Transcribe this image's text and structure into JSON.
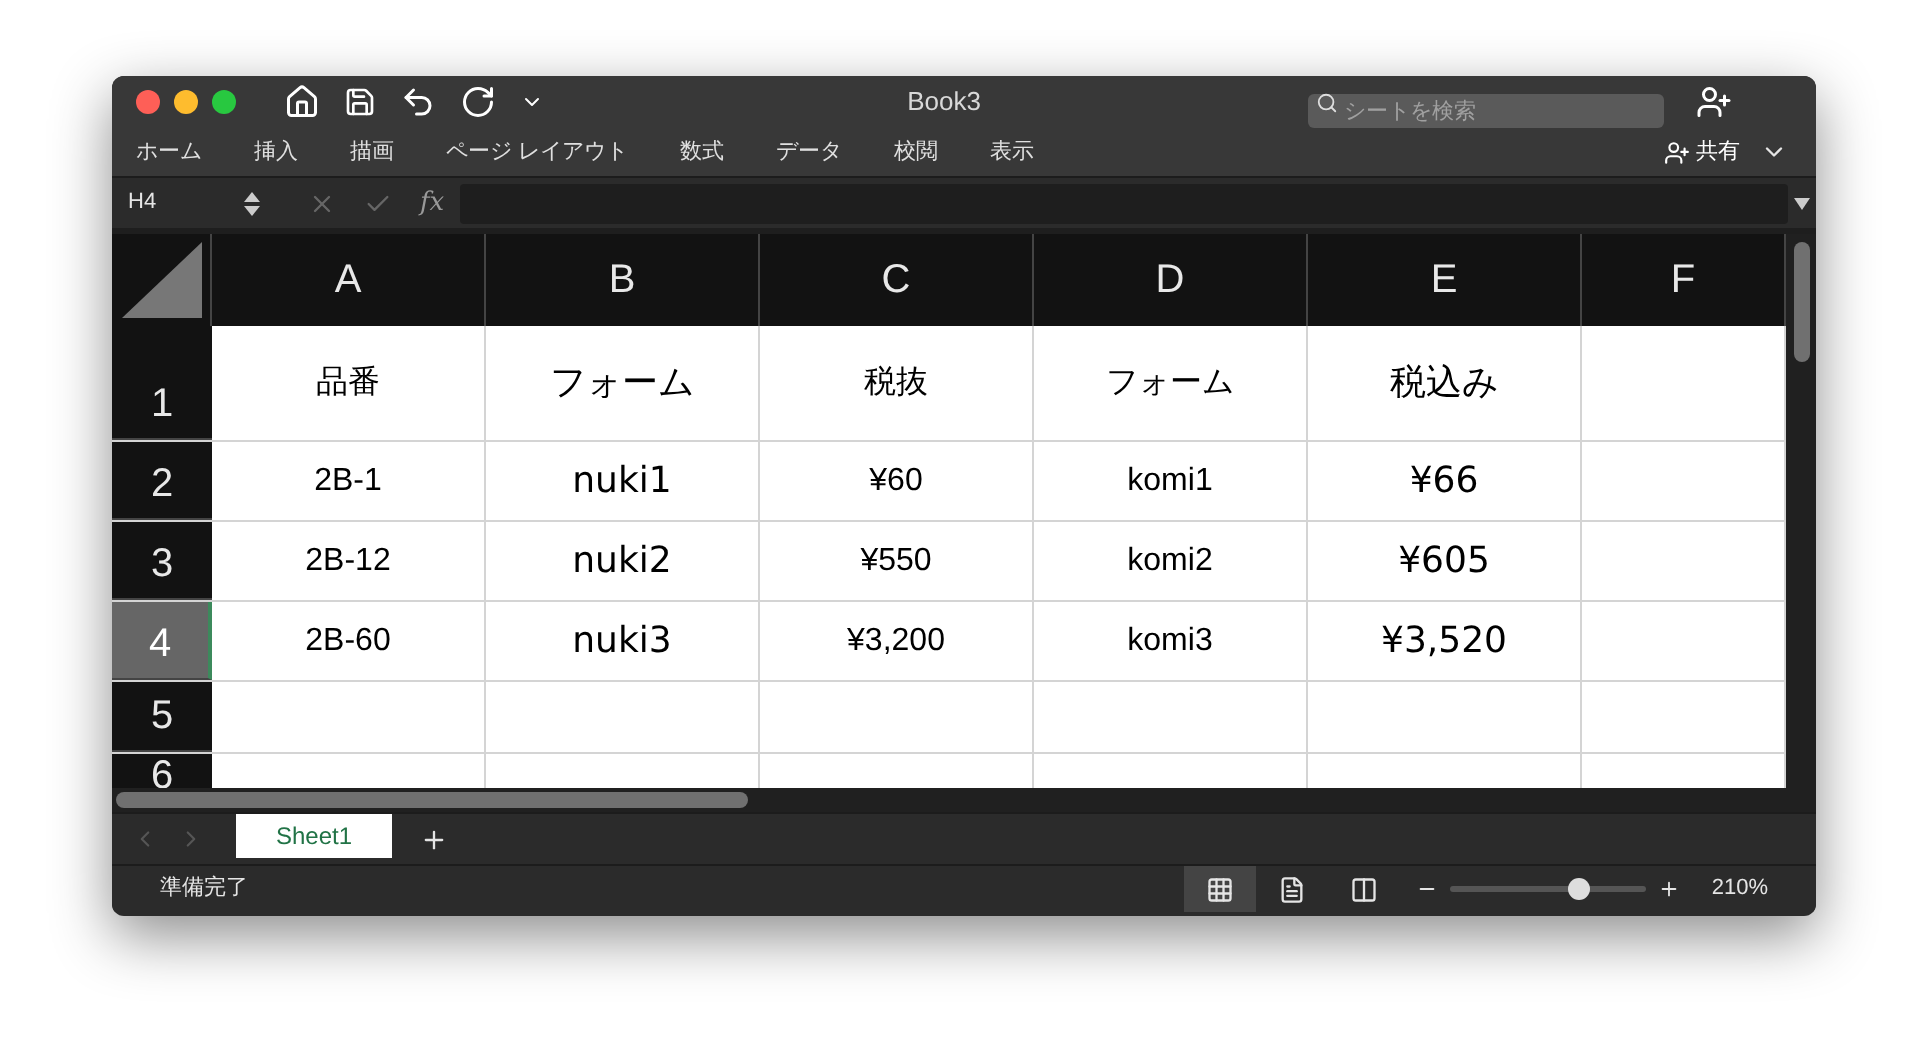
{
  "window": {
    "title": "Book3"
  },
  "search": {
    "placeholder": "シートを検索"
  },
  "ribbon_tabs": [
    {
      "label": "ホーム",
      "selected": false
    },
    {
      "label": "挿入",
      "selected": false
    },
    {
      "label": "描画",
      "selected": false
    },
    {
      "label": "ページ レイアウト",
      "selected": false
    },
    {
      "label": "数式",
      "selected": false
    },
    {
      "label": "データ",
      "selected": false
    },
    {
      "label": "校閲",
      "selected": false
    },
    {
      "label": "表示",
      "selected": false
    }
  ],
  "share": {
    "label": "共有"
  },
  "formula_bar": {
    "name_box": "H4",
    "formula_symbol": "fx"
  },
  "sheet": {
    "columns": [
      {
        "label": "A",
        "selected": false
      },
      {
        "label": "B",
        "selected": false
      },
      {
        "label": "C",
        "selected": false
      },
      {
        "label": "D",
        "selected": false
      },
      {
        "label": "E",
        "selected": false
      },
      {
        "label": "F",
        "selected": false
      }
    ],
    "rows": [
      {
        "header": "1",
        "selected": false,
        "cells": [
          "品番",
          "フォーム",
          "税抜",
          "フォーム",
          "税込み"
        ]
      },
      {
        "header": "2",
        "selected": false,
        "cells": [
          "2B-1",
          "nuki1",
          "¥60",
          "komi1",
          "¥66"
        ]
      },
      {
        "header": "3",
        "selected": false,
        "cells": [
          "2B-12",
          "nuki2",
          "¥550",
          "komi2",
          "¥605"
        ]
      },
      {
        "header": "4",
        "selected": true,
        "cells": [
          "2B-60",
          "nuki3",
          "¥3,200",
          "komi3",
          "¥3,520"
        ]
      },
      {
        "header": "5",
        "selected": false,
        "cells": []
      },
      {
        "header": "6",
        "selected": false,
        "cells": []
      }
    ]
  },
  "sheet_tabs": [
    {
      "label": "Sheet1",
      "selected": true
    }
  ],
  "status_bar": {
    "status": "準備完了",
    "views": [
      {
        "kind": "normal",
        "selected": true
      },
      {
        "kind": "page_layout",
        "selected": false
      },
      {
        "kind": "page_break",
        "selected": false
      }
    ],
    "zoom": {
      "level": 0.65,
      "reading": "210%"
    }
  }
}
